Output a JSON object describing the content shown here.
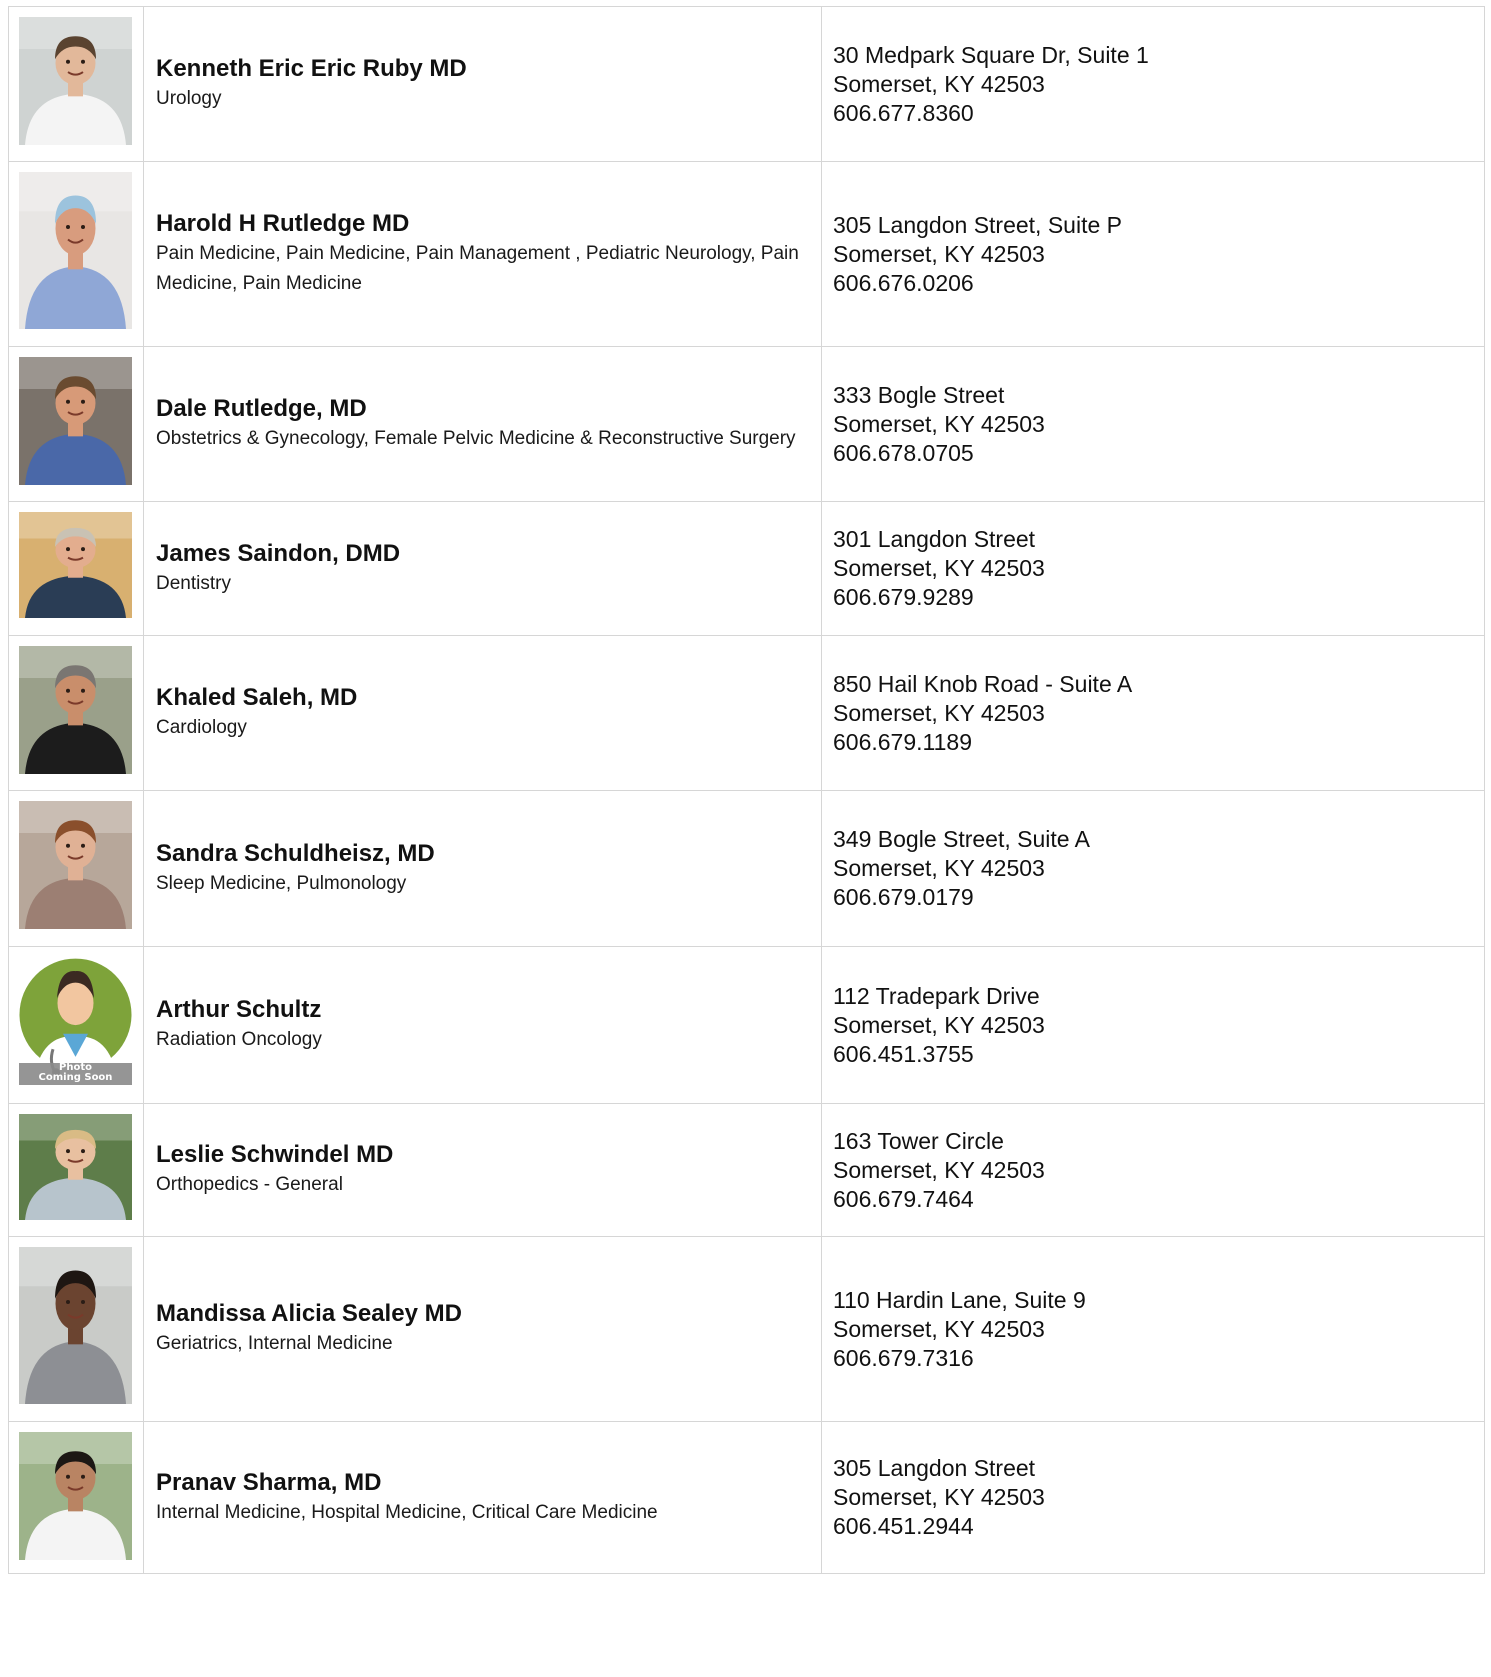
{
  "providers": [
    {
      "name": "Kenneth Eric Eric Ruby MD",
      "specialty": "Urology",
      "address": "30 Medpark Square Dr, Suite 1",
      "city": "Somerset, KY 42503",
      "phone": "606.677.8360",
      "photo": {
        "bg": "#cfd3d2",
        "skin": "#e2b89a",
        "hair": "#5a4330",
        "coat": "#f4f4f4"
      }
    },
    {
      "name": "Harold H Rutledge MD",
      "specialty": "Pain Medicine, Pain Medicine, Pain Management , Pediatric Neurology, Pain Medicine, Pain Medicine",
      "address": "305 Langdon Street, Suite P",
      "city": "Somerset, KY 42503",
      "phone": "606.676.0206",
      "photo": {
        "bg": "#e8e6e4",
        "skin": "#d89c7e",
        "hair": "#9cc3dd",
        "coat": "#8fa7d6"
      }
    },
    {
      "name": "Dale Rutledge, MD",
      "specialty": "Obstetrics & Gynecology, Female Pelvic Medicine & Reconstructive Surgery",
      "address": "333 Bogle Street",
      "city": "Somerset, KY 42503",
      "phone": "606.678.0705",
      "photo": {
        "bg": "#7a726a",
        "skin": "#d79a78",
        "hair": "#6a4b30",
        "coat": "#4a68a8"
      }
    },
    {
      "name": "James Saindon, DMD",
      "specialty": "Dentistry",
      "address": "301 Langdon Street",
      "city": "Somerset, KY 42503",
      "phone": "606.679.9289",
      "photo": {
        "bg": "#d8b070",
        "skin": "#e3ad8e",
        "hair": "#c9c2b4",
        "coat": "#2a3d55"
      }
    },
    {
      "name": "Khaled Saleh, MD",
      "specialty": "Cardiology",
      "address": "850 Hail Knob Road - Suite A",
      "city": "Somerset, KY 42503",
      "phone": "606.679.1189",
      "photo": {
        "bg": "#9aa08a",
        "skin": "#c98e6b",
        "hair": "#7a7672",
        "coat": "#1c1c1c"
      }
    },
    {
      "name": "Sandra Schuldheisz, MD",
      "specialty": "Sleep Medicine, Pulmonology",
      "address": "349 Bogle Street, Suite A",
      "city": "Somerset, KY 42503",
      "phone": "606.679.0179",
      "photo": {
        "bg": "#b7a79a",
        "skin": "#e0b195",
        "hair": "#8a4f2c",
        "coat": "#9c7f73"
      }
    },
    {
      "name": "Arthur Schultz",
      "specialty": "Radiation Oncology",
      "address": "112 Tradepark Drive",
      "city": "Somerset, KY 42503",
      "phone": "606.451.3755",
      "photo": {
        "bg": "#7ea33a",
        "skin": "#f2c6a0",
        "hair": "#3b2a22",
        "coat": "#ffffff"
      },
      "placeholder_caption": "Photo Coming Soon"
    },
    {
      "name": "Leslie Schwindel MD",
      "specialty": "Orthopedics - General",
      "address": "163 Tower Circle",
      "city": "Somerset, KY 42503",
      "phone": "606.679.7464",
      "photo": {
        "bg": "#5e7d4a",
        "skin": "#e8c0a0",
        "hair": "#d9bb85",
        "coat": "#b7c4cc"
      }
    },
    {
      "name": "Mandissa Alicia Sealey MD",
      "specialty": "Geriatrics, Internal Medicine",
      "address": "110 Hardin Lane, Suite 9",
      "city": "Somerset, KY 42503",
      "phone": "606.679.7316",
      "photo": {
        "bg": "#c9cbc8",
        "skin": "#6b4430",
        "hair": "#1e1612",
        "coat": "#8d8f94"
      }
    },
    {
      "name": "Pranav Sharma, MD",
      "specialty": "Internal Medicine, Hospital Medicine, Critical Care Medicine",
      "address": "305 Langdon Street",
      "city": "Somerset, KY 42503",
      "phone": "606.451.2944",
      "photo": {
        "bg": "#9db38a",
        "skin": "#b98463",
        "hair": "#1c1714",
        "coat": "#f4f4f4"
      }
    }
  ]
}
